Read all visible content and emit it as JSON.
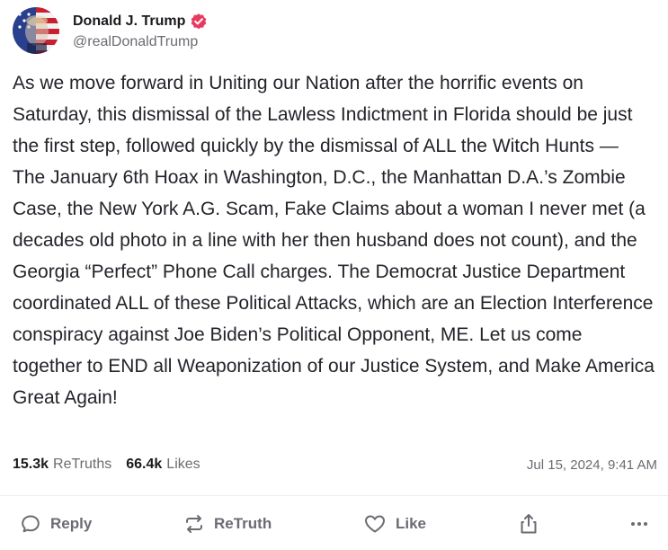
{
  "author": {
    "display_name": "Donald J. Trump",
    "handle": "@realDonaldTrump",
    "verified_color": "#e63b5f"
  },
  "post": {
    "text": "As we move forward in Uniting our Nation after the horrific events on Saturday, this dismissal of the Lawless Indictment in Florida should be just the first step, followed quickly by the dismissal of ALL the Witch Hunts — The January 6th Hoax in Washington, D.C., the Manhattan D.A.’s Zombie Case, the New York A.G. Scam, Fake Claims about a woman I never met (a decades old photo in a line with her then husband does not count), and the Georgia “Perfect” Phone Call charges. The Democrat Justice Department coordinated ALL of these Political Attacks, which are an Election Interference conspiracy against Joe Biden’s Political Opponent, ME. Let us come together to END all Weaponization of our Justice System, and Make America Great Again!",
    "timestamp": "Jul 15, 2024, 9:41 AM"
  },
  "stats": {
    "retruths_count": "15.3k",
    "retruths_label": "ReTruths",
    "likes_count": "66.4k",
    "likes_label": "Likes"
  },
  "actions": {
    "reply_label": "Reply",
    "retruth_label": "ReTruth",
    "like_label": "Like"
  },
  "icons": {
    "reply": "speech-bubble-icon",
    "retruth": "repost-arrows-icon",
    "like": "heart-icon",
    "share": "share-upload-icon",
    "more": "more-dots-icon",
    "verified": "verified-badge-icon"
  }
}
